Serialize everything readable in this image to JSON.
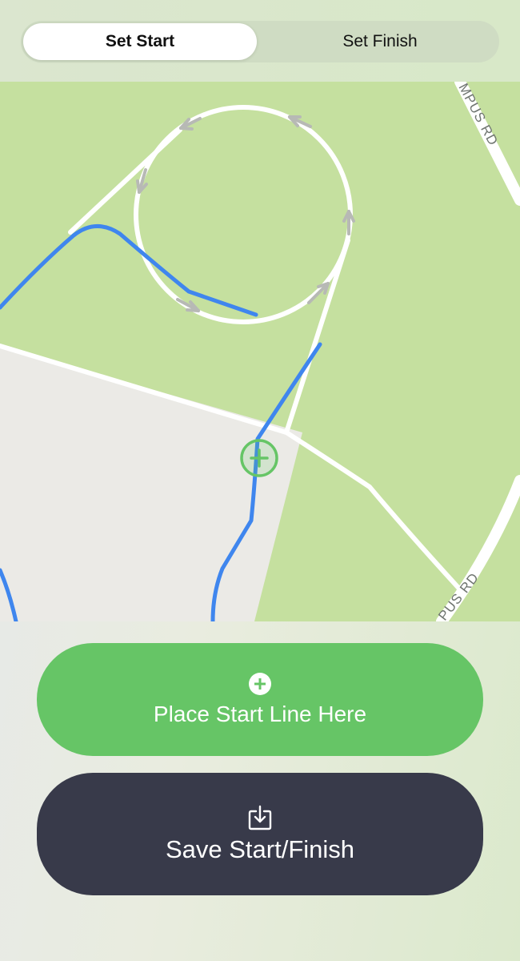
{
  "segmented_control": {
    "options": [
      {
        "label": "Set Start",
        "selected": true
      },
      {
        "label": "Set Finish",
        "selected": false
      }
    ]
  },
  "map": {
    "road_labels": [
      "MPUS RD",
      "PUS RD"
    ],
    "marker_icon": "plus-circle-icon",
    "colors": {
      "park": "#c5e09f",
      "area": "#ebeae6",
      "path": "#ffffff",
      "route": "#3f86ee",
      "marker": "#66c566",
      "direction_arrows": "#b7b9b5"
    }
  },
  "actions": {
    "place_label": "Place Start Line Here",
    "place_icon": "plus-circle-icon",
    "save_label": "Save Start/Finish",
    "save_icon": "download-tray-icon"
  },
  "colors": {
    "place_button": "#66c566",
    "save_button": "#383a4a"
  }
}
